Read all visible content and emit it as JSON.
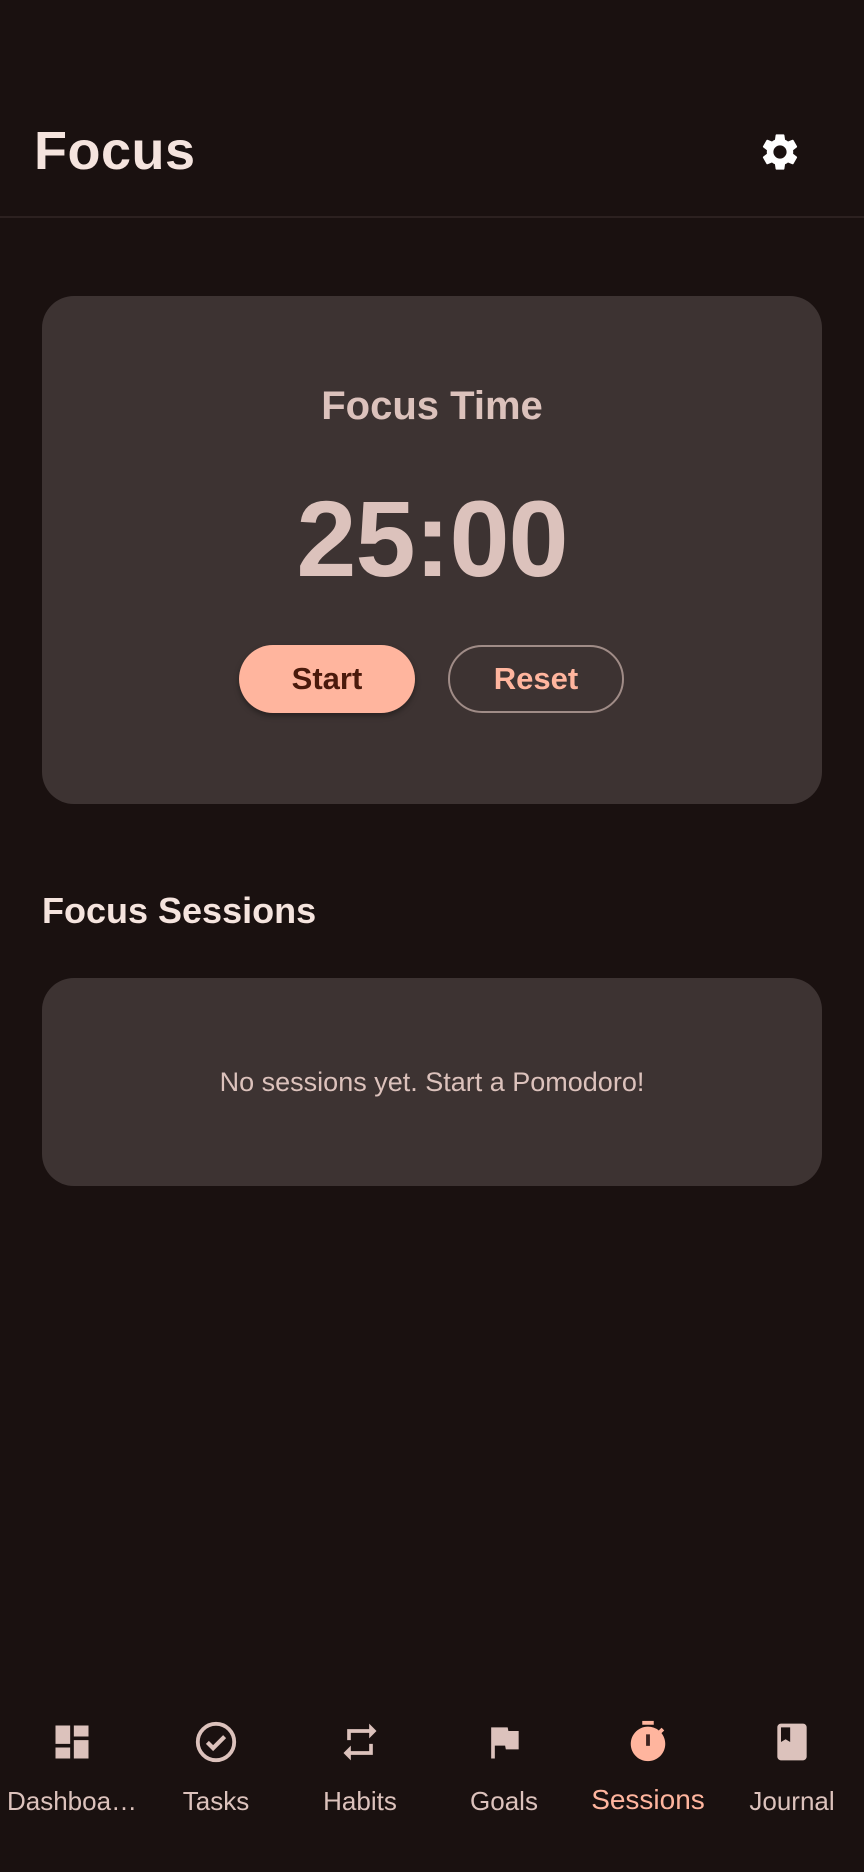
{
  "app_bar": {
    "title": "Focus",
    "settings_icon": "gear-icon"
  },
  "timer": {
    "label": "Focus Time",
    "time": "25:00",
    "start_label": "Start",
    "reset_label": "Reset"
  },
  "sessions": {
    "title": "Focus Sessions",
    "empty_text": "No sessions yet. Start a Pomodoro!"
  },
  "nav": {
    "items": [
      {
        "label": "Dashboa…",
        "icon": "dashboard-icon",
        "active": false
      },
      {
        "label": "Tasks",
        "icon": "check-circle-icon",
        "active": false
      },
      {
        "label": "Habits",
        "icon": "repeat-icon",
        "active": false
      },
      {
        "label": "Goals",
        "icon": "flag-icon",
        "active": false
      },
      {
        "label": "Sessions",
        "icon": "timer-icon",
        "active": true
      },
      {
        "label": "Journal",
        "icon": "book-icon",
        "active": false
      }
    ]
  },
  "colors": {
    "background": "#1a1110",
    "surface": "#3d3332",
    "accent": "#ffb59e",
    "on_surface": "#dcc2bc",
    "title": "#f5e4de"
  }
}
